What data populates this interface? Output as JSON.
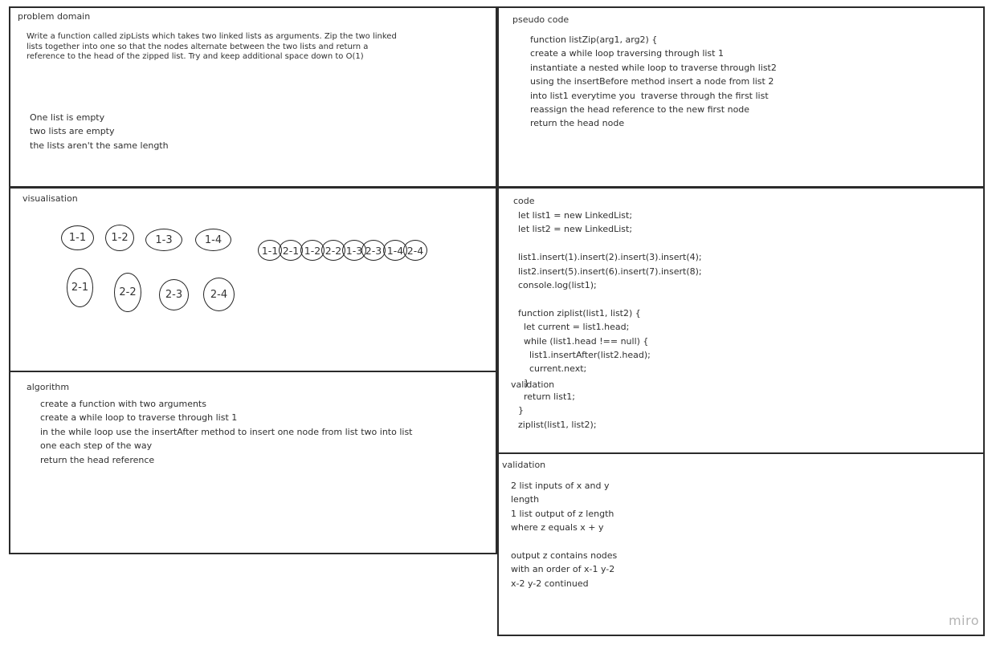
{
  "problem_domain": {
    "title": "problem domain",
    "description": [
      "Write a function called zipLists which takes two linked lists as arguments. Zip the two linked",
      "lists together into one so that the nodes alternate between the two lists and return a",
      "reference to the head of the zipped list. Try and keep additional space down to O(1)"
    ],
    "edge_cases": [
      "One list is empty",
      "two lists are empty",
      "the lists aren't the same length"
    ]
  },
  "pseudo_code": {
    "title": "pseudo code",
    "lines": [
      "function listZip(arg1, arg2) {",
      "create a while loop traversing through list 1",
      "instantiate a nested while loop to traverse through list2",
      "using the insertBefore method insert a node from list 2",
      "into list1 everytime you  traverse through the first list",
      "reassign the head reference to the new first node",
      "return the head node"
    ]
  },
  "visualisation": {
    "title": "visualisation",
    "list1": [
      "1-1",
      "1-2",
      "1-3",
      "1-4"
    ],
    "list2": [
      "2-1",
      "2-2",
      "2-3",
      "2-4"
    ],
    "zipped": [
      "1-1",
      "2-1",
      "1-2",
      "2-2",
      "1-3",
      "2-3",
      "1-4",
      "2-4"
    ]
  },
  "code": {
    "title": "code",
    "lines": [
      "  let list1 = new LinkedList;",
      "  let list2 = new LinkedList;",
      "",
      "  list1.insert(1).insert(2).insert(3).insert(4);",
      "  list2.insert(5).insert(6).insert(7).insert(8);",
      "  console.log(list1);",
      "",
      "  function ziplist(list1, list2) {",
      "    let current = list1.head;",
      "    while (list1.head !== null) {",
      "      list1.insertAfter(list2.head);",
      "      current.next;",
      "    }",
      "    return list1;",
      "  }",
      "  ziplist(list1, list2);"
    ],
    "overlap_label": "validation"
  },
  "algorithm": {
    "title": "algorithm",
    "lines": [
      "create a function with two arguments",
      "create a while loop to traverse through list 1",
      "in the while loop use the insertAfter method to insert one node from list two into list",
      "one each step of the way",
      "return the head reference"
    ]
  },
  "validation": {
    "title": "validation",
    "lines": [
      "2 list inputs of x and y",
      "length",
      "1 list output of z length",
      "where z equals x + y",
      "",
      "output z contains nodes",
      "with an order of x-1 y-2",
      "x-2 y-2 continued"
    ]
  },
  "watermark": "miro"
}
